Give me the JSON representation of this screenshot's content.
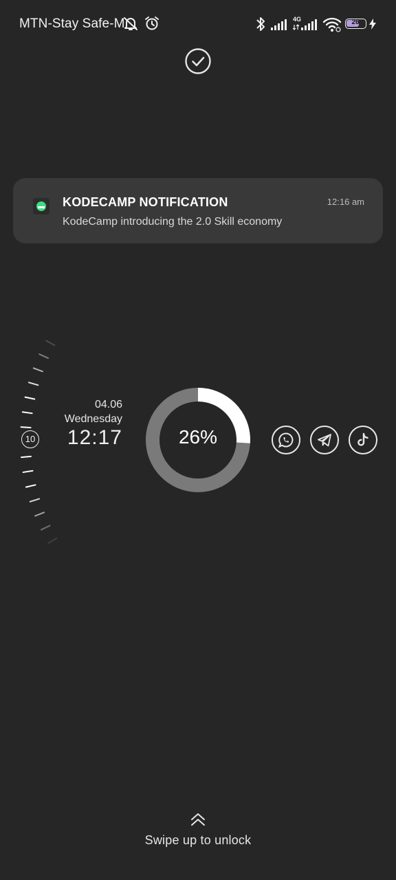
{
  "status_bar": {
    "carrier": "MTN-Stay Safe-M",
    "network_type": "4G",
    "battery_level": "26",
    "icons": [
      "muted-notifications-icon",
      "alarm-icon",
      "bluetooth-icon",
      "signal-icon",
      "signal-4g-icon",
      "wifi-icon",
      "battery-icon",
      "charging-icon"
    ]
  },
  "notification": {
    "title": "KODECAMP NOTIFICATION",
    "time": "12:16 am",
    "body": "KodeCamp introducing the 2.0 Skill economy",
    "app_icon": "kodecamp-app-icon"
  },
  "clock": {
    "dial_number": "10",
    "date": "04.06",
    "weekday": "Wednesday",
    "time": "12:17"
  },
  "battery": {
    "percent_label": "26%",
    "fraction": 0.26,
    "fill_color": "#ffffff",
    "track_color": "#7a7a7a"
  },
  "shortcuts": [
    {
      "icon": "whatsapp-icon"
    },
    {
      "icon": "telegram-icon"
    },
    {
      "icon": "tiktok-icon"
    }
  ],
  "unlock": {
    "text": "Swipe up to unlock"
  },
  "colors": {
    "background": "#262626",
    "notification_bg": "#393939",
    "app_icon_green": "#3ddc84"
  }
}
